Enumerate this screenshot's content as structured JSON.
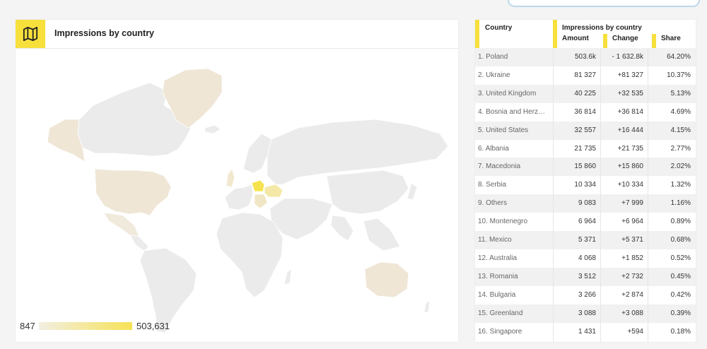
{
  "colors": {
    "accent": "#f7e03c",
    "country_fill": "#ecebeb",
    "country_stroke": "#ffffff",
    "low": "#f2eee2",
    "high": "#f6e256"
  },
  "map_card": {
    "icon": "map-icon",
    "title": "Impressions by country",
    "legend": {
      "min": "847",
      "max": "503,631"
    }
  },
  "table": {
    "headers": {
      "country": "Country",
      "group": "Impressions by country",
      "amount": "Amount",
      "change": "Change",
      "share": "Share"
    },
    "rows": [
      {
        "name": "1. Poland",
        "amount": "503.6k",
        "change": "- 1 632.8k",
        "share": "64.20%"
      },
      {
        "name": "2. Ukraine",
        "amount": "81 327",
        "change": "+81 327",
        "share": "10.37%"
      },
      {
        "name": "3. United Kingdom",
        "amount": "40 225",
        "change": "+32 535",
        "share": "5.13%"
      },
      {
        "name": "4. Bosnia and Herze…",
        "amount": "36 814",
        "change": "+36 814",
        "share": "4.69%"
      },
      {
        "name": "5. United States",
        "amount": "32 557",
        "change": "+16 444",
        "share": "4.15%"
      },
      {
        "name": "6. Albania",
        "amount": "21 735",
        "change": "+21 735",
        "share": "2.77%"
      },
      {
        "name": "7. Macedonia",
        "amount": "15 860",
        "change": "+15 860",
        "share": "2.02%"
      },
      {
        "name": "8. Serbia",
        "amount": "10 334",
        "change": "+10 334",
        "share": "1.32%"
      },
      {
        "name": "9. Others",
        "amount": "9 083",
        "change": "+7 999",
        "share": "1.16%"
      },
      {
        "name": "10. Montenegro",
        "amount": "6 964",
        "change": "+6 964",
        "share": "0.89%"
      },
      {
        "name": "11. Mexico",
        "amount": "5 371",
        "change": "+5 371",
        "share": "0.68%"
      },
      {
        "name": "12. Australia",
        "amount": "4 068",
        "change": "+1 852",
        "share": "0.52%"
      },
      {
        "name": "13. Romania",
        "amount": "3 512",
        "change": "+2 732",
        "share": "0.45%"
      },
      {
        "name": "14. Bulgaria",
        "amount": "3 266",
        "change": "+2 874",
        "share": "0.42%"
      },
      {
        "name": "15. Greenland",
        "amount": "3 088",
        "change": "+3 088",
        "share": "0.39%"
      },
      {
        "name": "16. Singapore",
        "amount": "1 431",
        "change": "+594",
        "share": "0.18%"
      }
    ]
  }
}
